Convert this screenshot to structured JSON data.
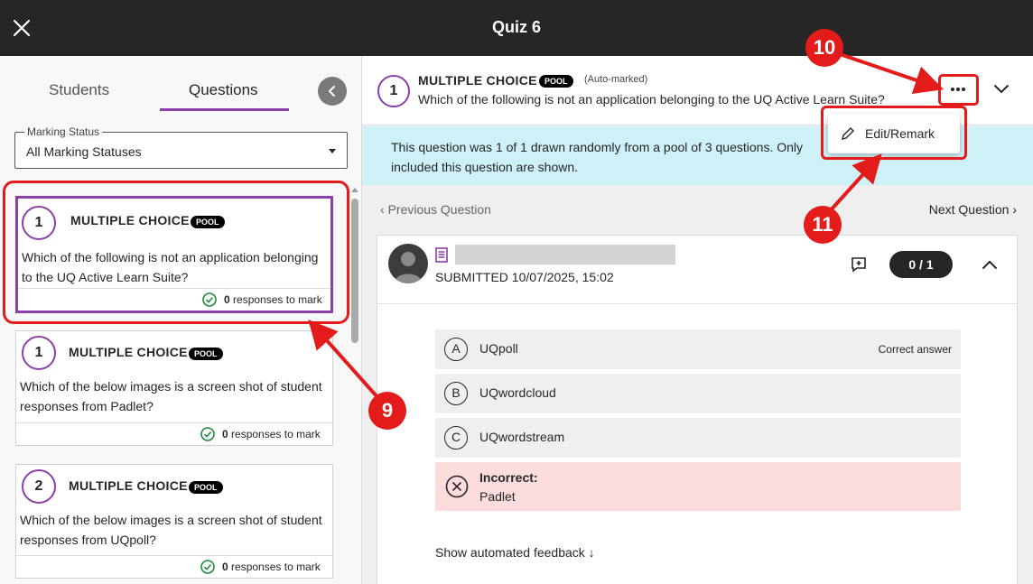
{
  "app": {
    "title": "Quiz 6"
  },
  "left": {
    "tabs": [
      {
        "label": "Students"
      },
      {
        "label": "Questions"
      }
    ],
    "marking_status": {
      "legend": "Marking Status",
      "value": "All Marking Statuses"
    },
    "questions": [
      {
        "number": "1",
        "type": "MULTIPLE CHOICE",
        "badge": "POOL",
        "text": "Which of the following is not an application belonging to the UQ Active Learn Suite?",
        "responses_count": "0",
        "responses_label": "responses to mark"
      },
      {
        "number": "1",
        "type": "MULTIPLE CHOICE",
        "badge": "POOL",
        "text": "Which of the below images is a screen shot of student responses from Padlet?",
        "responses_count": "0",
        "responses_label": "responses to mark"
      },
      {
        "number": "2",
        "type": "MULTIPLE CHOICE",
        "badge": "POOL",
        "text": "Which of the below images is a screen shot of student responses from UQpoll?",
        "responses_count": "0",
        "responses_label": "responses to mark"
      }
    ]
  },
  "question": {
    "number": "1",
    "type": "MULTIPLE CHOICE",
    "badge": "POOL",
    "auto_label": "(Auto-marked)",
    "text": "Which of the following is not an application belonging to the UQ Active Learn Suite?",
    "info_banner": "This question was 1 of 1 drawn randomly from a pool of 3 questions. Only\nincluded this question are shown.",
    "menu_item": "Edit/Remark",
    "prev_label": "Previous Question",
    "next_label": "Next Question"
  },
  "submission": {
    "submitted": "SUBMITTED 10/07/2025, 15:02",
    "score": "0 / 1",
    "options": [
      {
        "letter": "A",
        "text": "UQpoll",
        "note": "Correct answer"
      },
      {
        "letter": "B",
        "text": "UQwordcloud"
      },
      {
        "letter": "C",
        "text": "UQwordstream"
      }
    ],
    "incorrect": {
      "label": "Incorrect:",
      "text": "Padlet"
    },
    "feedback_link": "Show automated feedback"
  },
  "annotations": {
    "step_9": "9",
    "step_10": "10",
    "step_11": "11"
  },
  "colors": {
    "accent": "#8c3fa8",
    "annotation": "#e31b1b",
    "topbar": "#262626",
    "info": "#cdf1f7",
    "incorrect": "#fcdcdc"
  }
}
